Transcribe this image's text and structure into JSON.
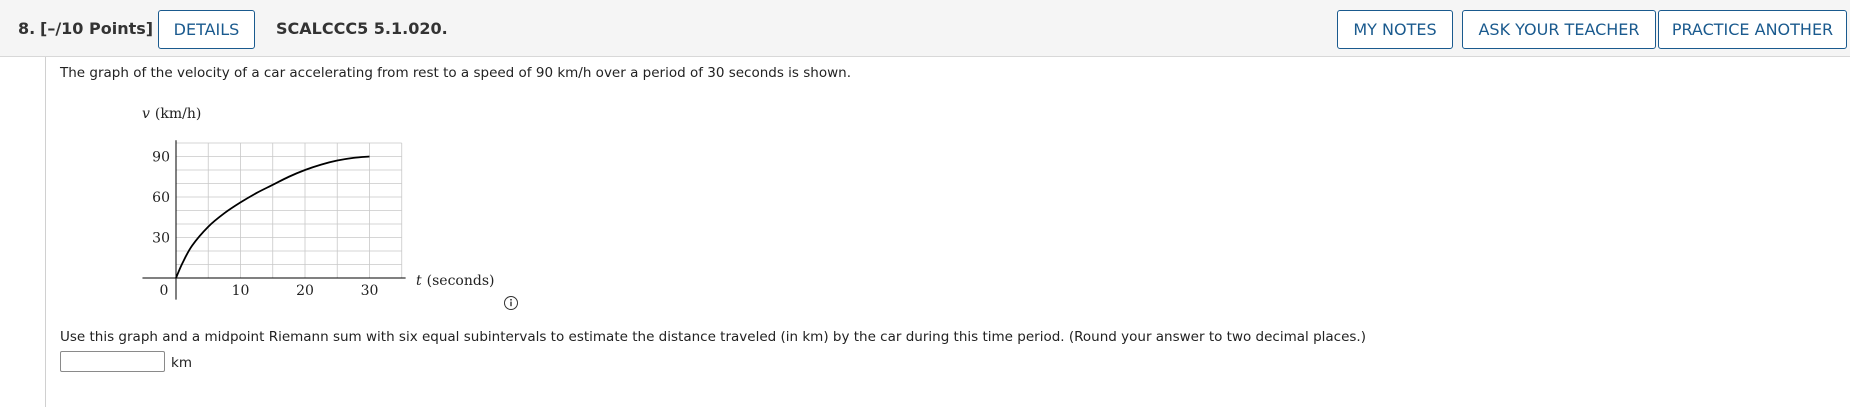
{
  "header": {
    "number": "8.",
    "points": "[–/10 Points]",
    "details_label": "DETAILS",
    "code": "SCALCCC5 5.1.020.",
    "my_notes_label": "MY NOTES",
    "ask_teacher_label": "ASK YOUR TEACHER",
    "practice_label": "PRACTICE ANOTHER"
  },
  "prompt": "The graph of the velocity of a car accelerating from rest to a speed of 90 km/h over a period of 30 seconds is shown.",
  "question": "Use this graph and a midpoint Riemann sum with six equal subintervals to estimate the distance traveled (in km) by the car during this time period. (Round your answer to two decimal places.)",
  "answer": {
    "value": "",
    "unit": "km"
  },
  "colors": {
    "accent": "#1a5a8e",
    "grid": "#c8c8c8",
    "header_bg": "#f5f5f5"
  },
  "chart_data": {
    "type": "line",
    "ylabel_italic": "v",
    "ylabel_rest": "(km/h)",
    "xlabel_italic": "t",
    "xlabel_rest": "(seconds)",
    "xlim": [
      0,
      35
    ],
    "ylim": [
      0,
      100
    ],
    "grid": true,
    "x_ticks": [
      {
        "value": 0,
        "label": "0"
      },
      {
        "value": 10,
        "label": "10"
      },
      {
        "value": 20,
        "label": "20"
      },
      {
        "value": 30,
        "label": "30"
      }
    ],
    "y_ticks": [
      {
        "value": 30,
        "label": "30"
      },
      {
        "value": 60,
        "label": "60"
      },
      {
        "value": 90,
        "label": "90"
      }
    ],
    "series": [
      {
        "x": [
          0,
          1,
          2.5,
          5,
          7.5,
          10,
          12.5,
          15,
          17.5,
          20,
          22.5,
          25,
          27.5,
          30
        ],
        "y": [
          0,
          11,
          24,
          38,
          48,
          56,
          63,
          69,
          75,
          80,
          84,
          87,
          89,
          90
        ]
      }
    ]
  }
}
